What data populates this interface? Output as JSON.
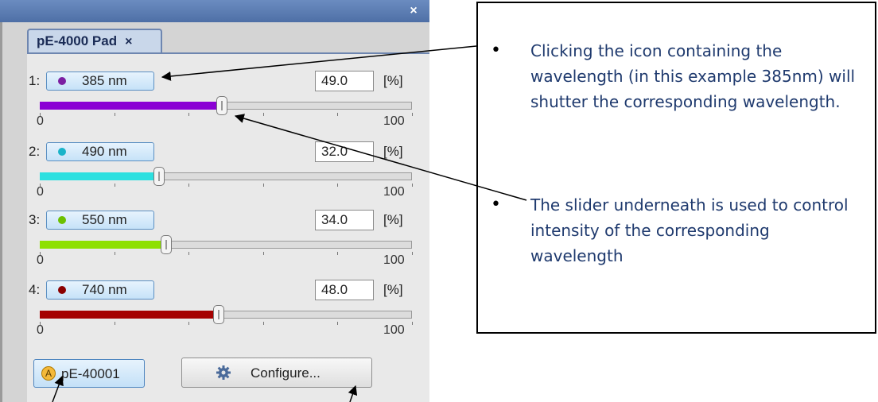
{
  "window": {
    "close_glyph": "×"
  },
  "tab": {
    "title": "pE-4000 Pad",
    "close_glyph": "×"
  },
  "channels": [
    {
      "index": "1:",
      "wavelength": "385 nm",
      "value": "49.0",
      "unit": "[%]",
      "level": 49.0,
      "color": "#8a00d4",
      "dot": "#7b1fa2"
    },
    {
      "index": "2:",
      "wavelength": "490 nm",
      "value": "32.0",
      "unit": "[%]",
      "level": 32.0,
      "color": "#2de0e0",
      "dot": "#1ab3c9"
    },
    {
      "index": "3:",
      "wavelength": "550 nm",
      "value": "34.0",
      "unit": "[%]",
      "level": 34.0,
      "color": "#8ee000",
      "dot": "#6cc000"
    },
    {
      "index": "4:",
      "wavelength": "740 nm",
      "value": "48.0",
      "unit": "[%]",
      "level": 48.0,
      "color": "#a50000",
      "dot": "#8b0000"
    }
  ],
  "slider": {
    "min_label": "0",
    "max_label": "100"
  },
  "buttons": {
    "device_badge": "A",
    "device_label": "pE-40001",
    "configure_label": "Configure..."
  },
  "callout": {
    "bullets": [
      "Clicking the icon containing the wavelength (in this example 385nm) will shutter the corresponding wavelength.",
      "The slider underneath is used to control intensity of the corresponding wavelength"
    ]
  },
  "icons": [
    "close-icon",
    "gear-icon",
    "wavelength-dot-icon"
  ]
}
